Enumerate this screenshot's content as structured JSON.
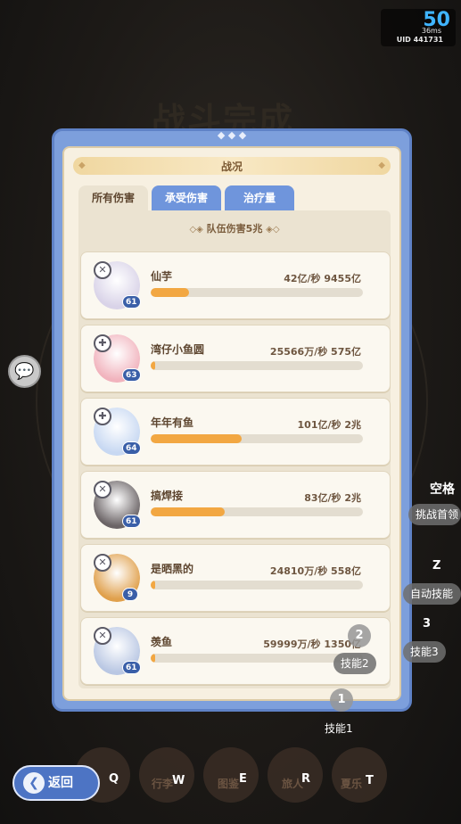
{
  "background": {
    "title": "战斗完成"
  },
  "hud": {
    "fps": "50",
    "ping": "36ms",
    "uid": "UID 441731"
  },
  "panel": {
    "title": "战况",
    "tabs": [
      "所有伤害",
      "承受伤害",
      "治疗量"
    ],
    "team_total": "队伍伤害5兆",
    "players": [
      {
        "name": "仙芋",
        "stats": "42亿/秒  9455亿",
        "level": "61",
        "role_icon": "sword-icon",
        "progress": 0.18,
        "color": "#d9d3e8"
      },
      {
        "name": "湾仔小鱼圆",
        "stats": "25566万/秒  575亿",
        "level": "63",
        "role_icon": "shield-icon",
        "progress": 0.01,
        "color": "#f1b3bd"
      },
      {
        "name": "年年有鱼",
        "stats": "101亿/秒  2兆",
        "level": "64",
        "role_icon": "shield-icon",
        "progress": 0.43,
        "color": "#c7d8f2"
      },
      {
        "name": "搞焊接",
        "stats": "83亿/秒  2兆",
        "level": "61",
        "role_icon": "sword-icon",
        "progress": 0.35,
        "color": "#6b6466"
      },
      {
        "name": "是晒黑的",
        "stats": "24810万/秒  558亿",
        "level": "9",
        "role_icon": "sword-icon",
        "progress": 0.01,
        "color": "#e0a04c"
      },
      {
        "name": "羡鱼",
        "stats": "59999万/秒  1350亿",
        "level": "61",
        "role_icon": "sword-icon",
        "progress": 0.02,
        "color": "#b9c7e3"
      }
    ]
  },
  "hints": {
    "space_key": "空格",
    "space_text": "挑战首领",
    "z_key": "Z",
    "z_text": "自动技能",
    "key3": "3",
    "skill3": "技能3",
    "key2": "2",
    "skill2": "技能2",
    "key1": "1",
    "skill1": "技能1"
  },
  "bottom_nav": {
    "back_label": "返回",
    "keys": [
      "Q",
      "W",
      "E",
      "R",
      "T"
    ],
    "labels": [
      "",
      "行李",
      "图鉴",
      "旅人",
      "夏乐"
    ]
  }
}
